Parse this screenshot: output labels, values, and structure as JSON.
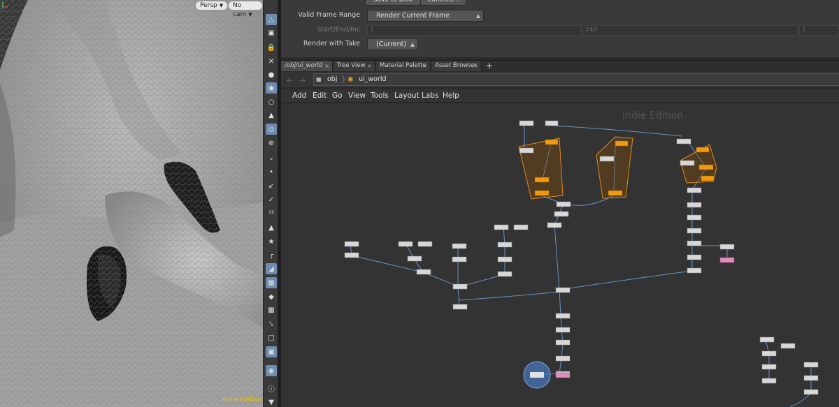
{
  "viewport": {
    "persp_label": "Persp",
    "cam_label": "No cam",
    "edition": "Indie Edition"
  },
  "params": {
    "save_to_disk": "Save to Disk",
    "controls": "Controls...",
    "valid_frame_range_label": "Valid Frame Range",
    "valid_frame_range_value": "Render Current Frame",
    "start_end_inc_label": "Start/End/Inc",
    "start_value": "1",
    "end_value": "240",
    "inc_value": "1",
    "render_with_take_label": "Render with Take",
    "render_with_take_value": "(Current)"
  },
  "tabs": [
    {
      "label": "/obj/ui_world",
      "active": true
    },
    {
      "label": "Tree View",
      "active": false
    },
    {
      "label": "Material Palette",
      "active": false
    },
    {
      "label": "Asset Browser",
      "active": false
    }
  ],
  "tab_add": "+",
  "path": {
    "crumb1": "obj",
    "crumb2": "ui_world"
  },
  "network_menu": [
    "Add",
    "Edit",
    "Go",
    "View",
    "Tools",
    "Layout",
    "Labs",
    "Help"
  ],
  "network": {
    "watermark": "Indie Edition"
  },
  "icons": [
    "persp-chevron-icon",
    "cam-chevron-icon",
    "select-tool-icon",
    "lock-icon",
    "tool-icons",
    "nav-back-icon",
    "nav-forward-icon",
    "obj-icon",
    "houdini-icon"
  ]
}
